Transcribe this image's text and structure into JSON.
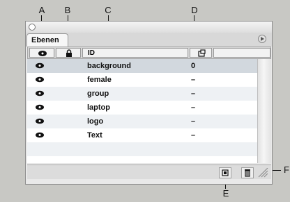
{
  "panel": {
    "tab_label": "Ebenen",
    "header_name_column": "ID"
  },
  "layers": [
    {
      "name": "background",
      "value": "0"
    },
    {
      "name": "female",
      "value": "–"
    },
    {
      "name": "group",
      "value": "–"
    },
    {
      "name": "laptop",
      "value": "–"
    },
    {
      "name": "logo",
      "value": "–"
    },
    {
      "name": "Text",
      "value": "–"
    }
  ],
  "callouts": {
    "a": "A",
    "b": "B",
    "c": "C",
    "d": "D",
    "e": "E",
    "f": "F"
  },
  "colors": {
    "background": "#c8c8c4",
    "selected_row": "#d2d8de",
    "alt_row": "#eef1f4"
  },
  "icons": {
    "eye_column": "eye-icon",
    "lock_column": "lock-icon",
    "new_layer": "new-layer-icon",
    "delete": "trash-icon",
    "grow": "resize-grip-icon"
  }
}
